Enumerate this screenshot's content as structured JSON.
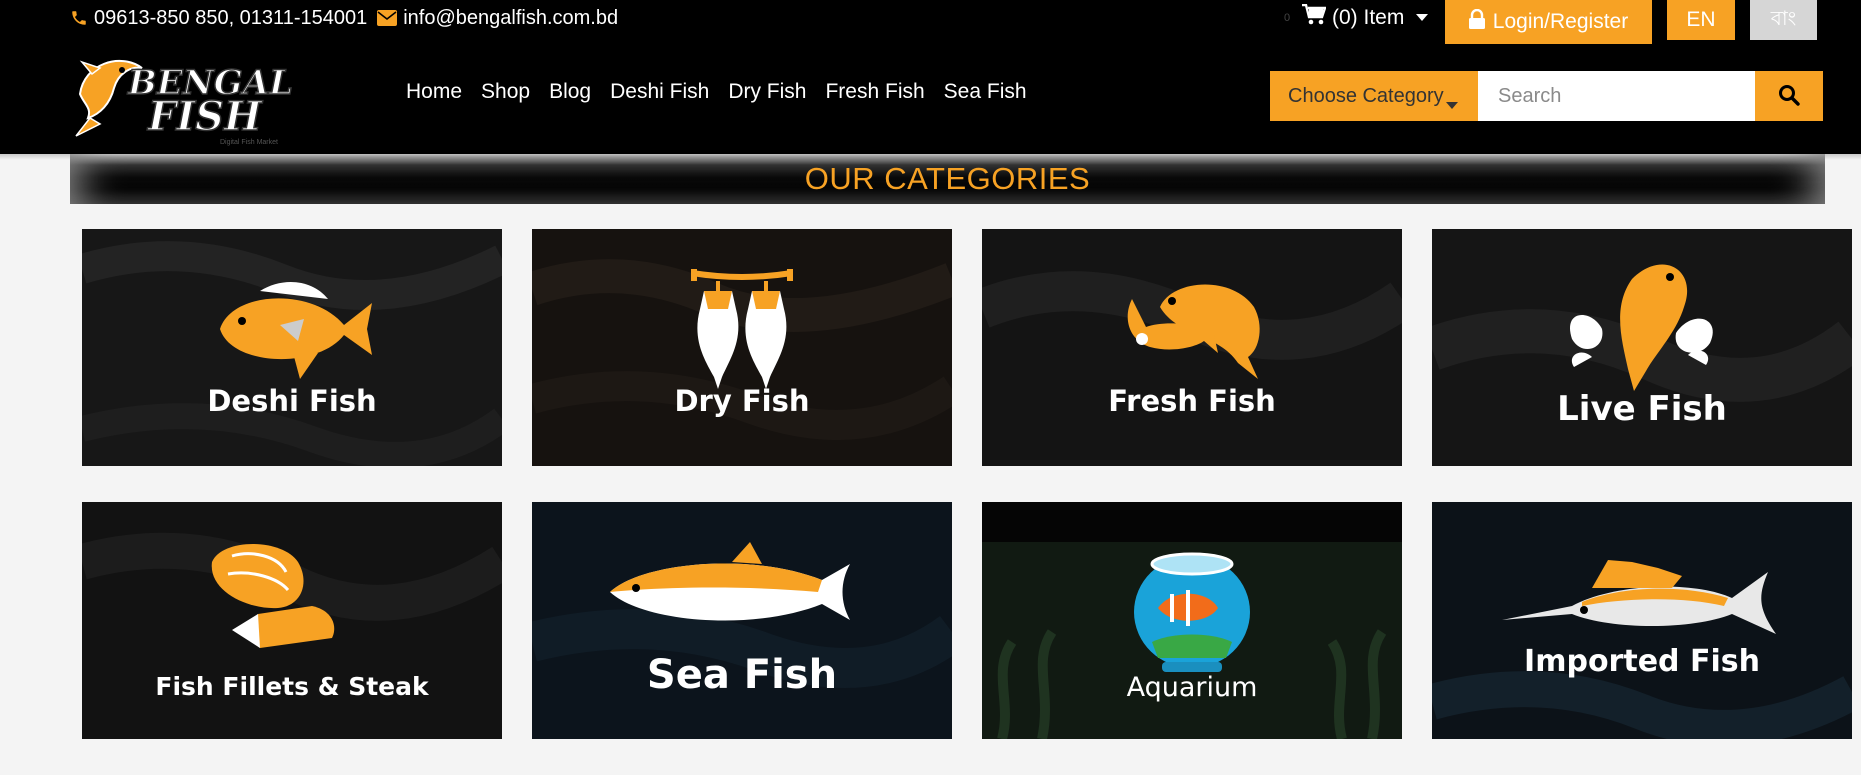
{
  "topbar": {
    "phone": "09613-850 850, 01311-154001",
    "email": "info@bengalfish.com.bd",
    "cart_count_small": "0",
    "cart_label": "(0) Item",
    "login_label": "Login/Register",
    "lang_en": "EN",
    "lang_bn": "বাং"
  },
  "logo": {
    "line1": "BENGAL",
    "line2": "FISH",
    "tagline": "Digital Fish Market"
  },
  "nav": {
    "items": [
      "Home",
      "Shop",
      "Blog",
      "Deshi Fish",
      "Dry Fish",
      "Fresh Fish",
      "Sea Fish"
    ]
  },
  "search": {
    "category_label": "Choose Category",
    "placeholder": "Search"
  },
  "section": {
    "title": "OUR CATEGORIES"
  },
  "categories": [
    {
      "label": "Deshi Fish",
      "icon": "deshi-fish-icon"
    },
    {
      "label": "Dry Fish",
      "icon": "dry-fish-icon"
    },
    {
      "label": "Fresh Fish",
      "icon": "fresh-fish-icon"
    },
    {
      "label": "Live Fish",
      "icon": "live-fish-icon"
    },
    {
      "label": "Fish Fillets & Steak",
      "icon": "fish-fillet-icon"
    },
    {
      "label": "Sea Fish",
      "icon": "tuna-icon"
    },
    {
      "label": "Aquarium",
      "icon": "fishbowl-icon"
    },
    {
      "label": "Imported Fish",
      "icon": "marlin-icon"
    }
  ],
  "colors": {
    "accent": "#f7a224",
    "header_bg": "#000000",
    "page_bg": "#f4f4f4"
  }
}
